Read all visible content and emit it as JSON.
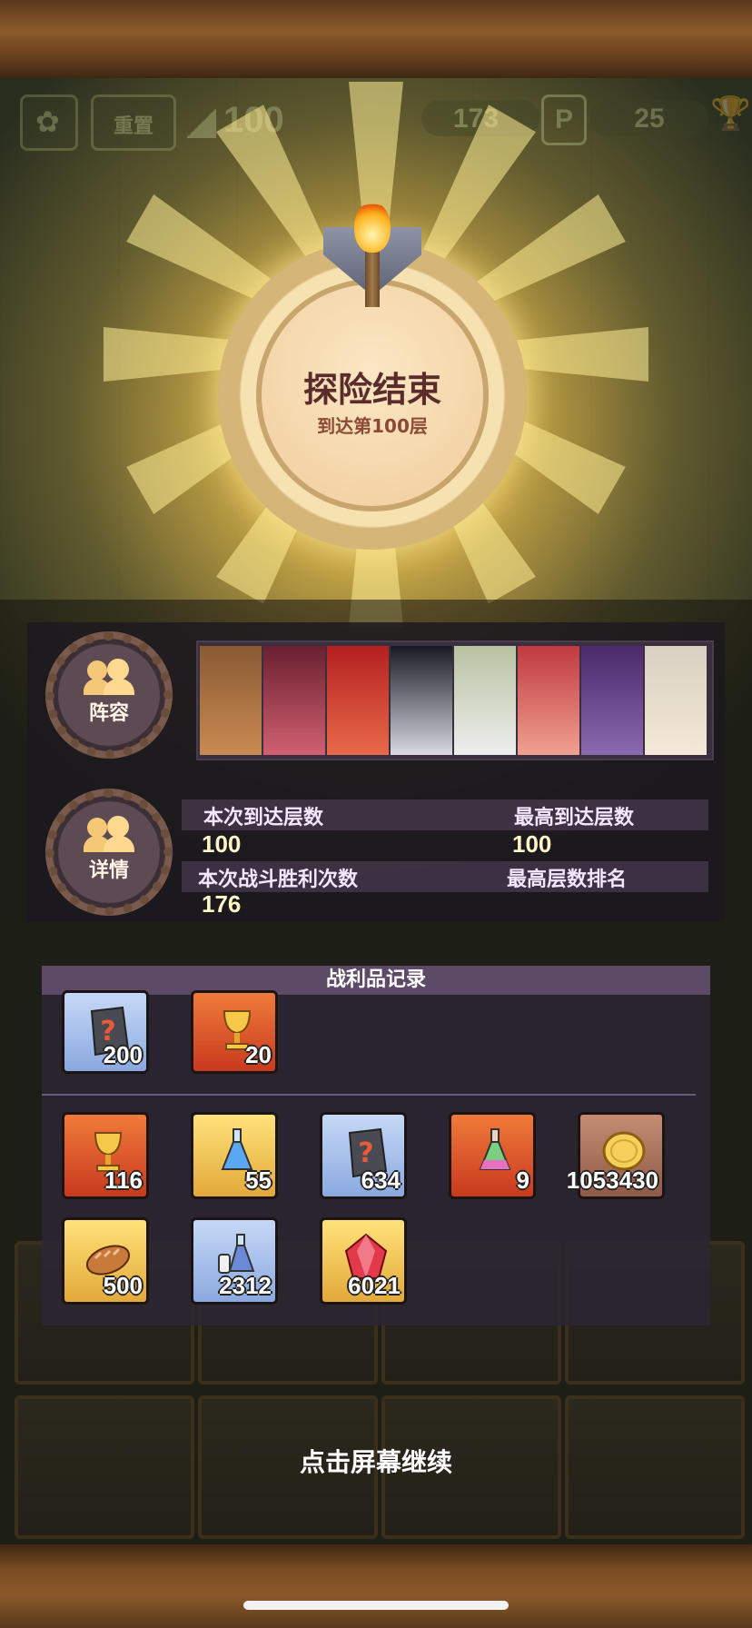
{
  "hud": {
    "reset_label": "重置",
    "floor_value": "100",
    "currency_value": "173",
    "trophy_value": "25"
  },
  "result": {
    "title": "探险结束",
    "subtitle": "到达第100层"
  },
  "team": {
    "label": "阵容",
    "heroes": [
      "hero-1",
      "hero-2",
      "hero-3",
      "hero-4",
      "hero-5",
      "hero-6",
      "hero-7",
      "hero-8"
    ]
  },
  "details": {
    "label": "详情",
    "current_floor_label": "本次到达层数",
    "current_floor_value": "100",
    "best_floor_label": "最高到达层数",
    "best_floor_value": "100",
    "wins_label": "本次战斗胜利次数",
    "wins_value": "176",
    "rank_label": "最高层数排名",
    "rank_value": ""
  },
  "loot": {
    "title": "战利品记录",
    "top_items": [
      {
        "icon": "mystery-rune-icon",
        "qty": "200",
        "rarity": "blue"
      },
      {
        "icon": "golden-chalice-icon",
        "qty": "20",
        "rarity": "red"
      }
    ],
    "items": [
      {
        "icon": "golden-chalice-icon",
        "qty": "116",
        "rarity": "red"
      },
      {
        "icon": "blue-potion-icon",
        "qty": "55",
        "rarity": "gold"
      },
      {
        "icon": "mystery-rune-icon",
        "qty": "634",
        "rarity": "blue"
      },
      {
        "icon": "rainbow-potion-icon",
        "qty": "9",
        "rarity": "red"
      },
      {
        "icon": "gold-coin-icon",
        "qty": "1053430",
        "rarity": "brown"
      },
      {
        "icon": "bread-icon",
        "qty": "500",
        "rarity": "gold"
      },
      {
        "icon": "potion-bottles-icon",
        "qty": "2312",
        "rarity": "blue"
      },
      {
        "icon": "red-gem-icon",
        "qty": "6021",
        "rarity": "gold"
      }
    ]
  },
  "continue_label": "点击屏幕继续",
  "colors": {
    "accent_gold": "#ffe27a",
    "medal_title": "#5a2c2c",
    "panel_bg": "#1c1820"
  }
}
